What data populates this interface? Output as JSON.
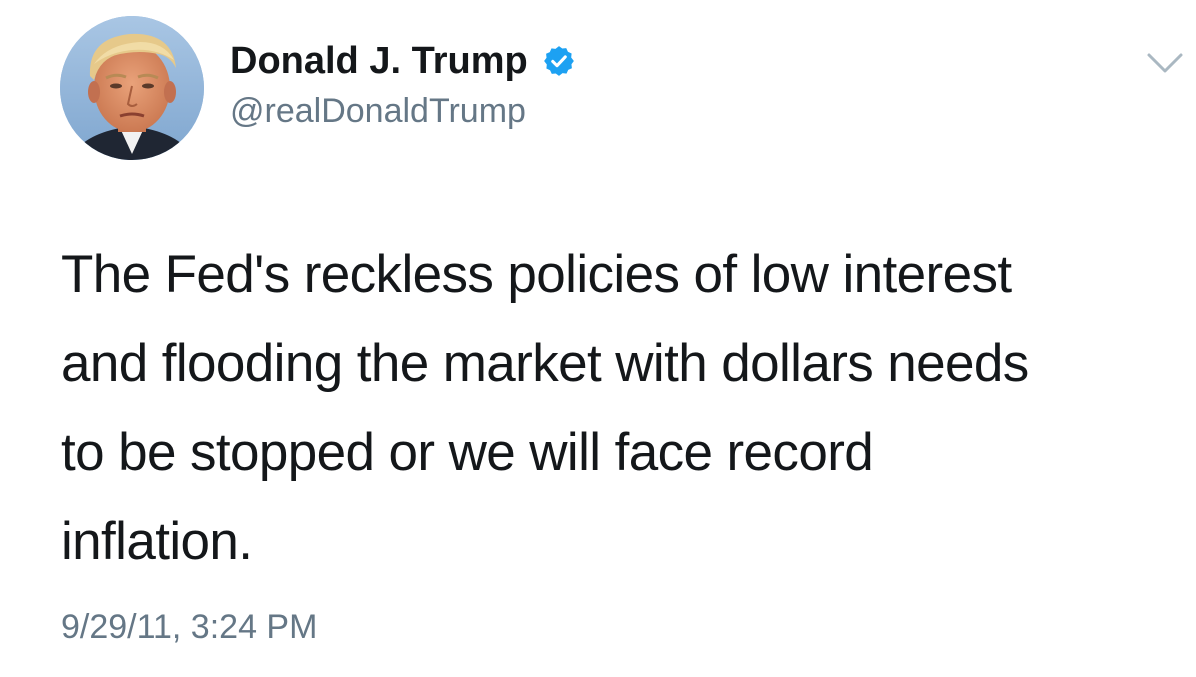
{
  "tweet": {
    "author": {
      "display_name": "Donald J. Trump",
      "handle": "@realDonaldTrump",
      "verified": true,
      "avatar_icon": "profile-photo",
      "verified_icon": "verified-badge-icon",
      "verified_color": "#1da1f2"
    },
    "menu_icon": "chevron-down-icon",
    "text": "The Fed's reckless policies of low interest\nand flooding the market with dollars needs\nto be stopped or we will face record\ninflation.",
    "timestamp": "9/29/11, 3:24 PM"
  },
  "colors": {
    "text_primary": "#14171a",
    "text_secondary": "#657786",
    "accent": "#1da1f2",
    "background": "#ffffff"
  }
}
